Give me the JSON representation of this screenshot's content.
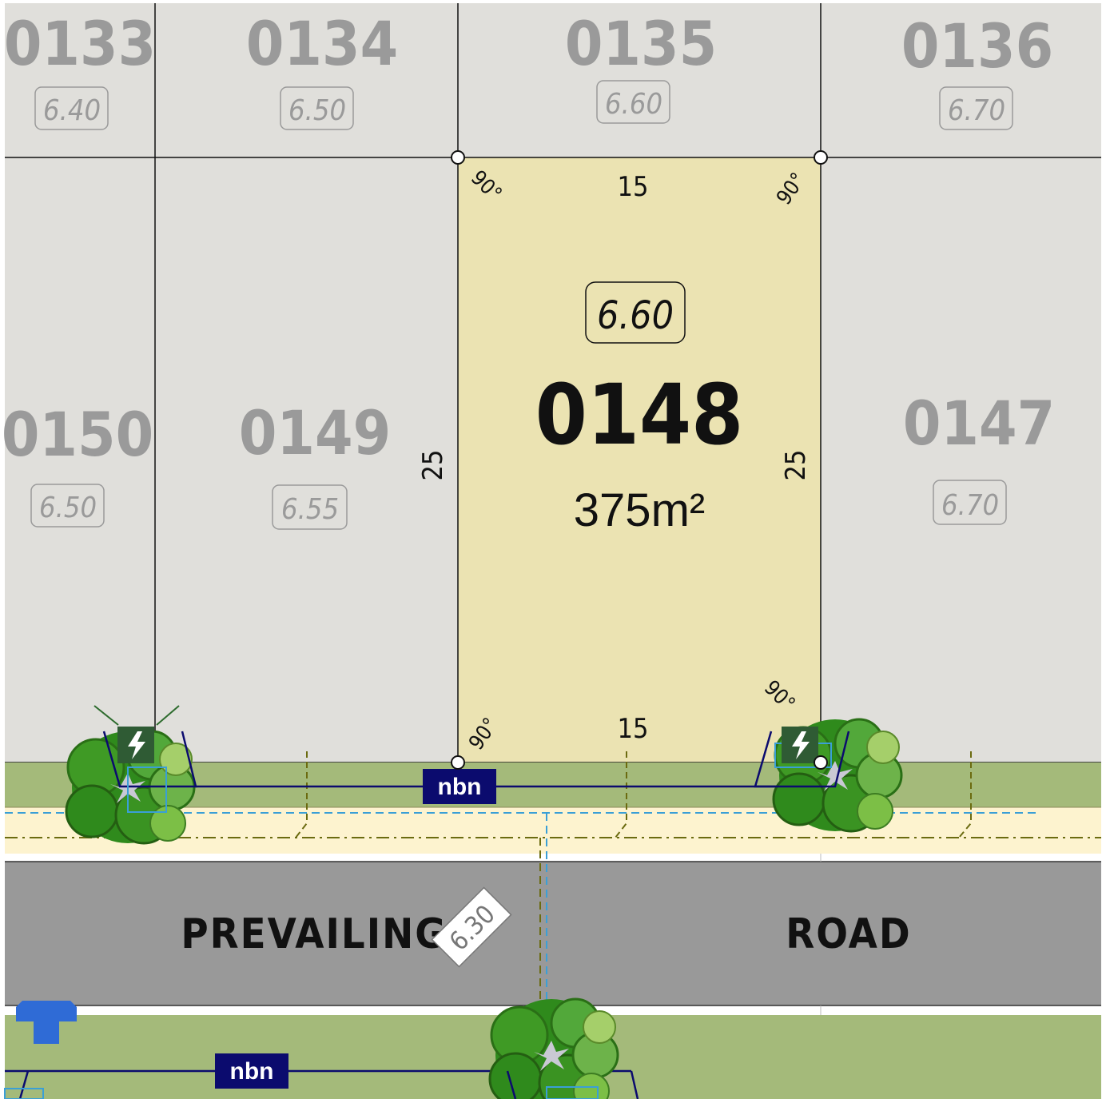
{
  "colors": {
    "lot_grey": "#e0dfdb",
    "lot_highlight": "#ebe3b2",
    "verge": "#a4ba7a",
    "footpath": "#fdf3cf",
    "road": "#999999",
    "nbn_bg": "#0b0b6e",
    "water_blue": "#3a9fd6",
    "boundary_line": "#111111",
    "hydrant_blue": "#2f6bd6"
  },
  "lots": [
    {
      "id": "0133",
      "level": "6.40"
    },
    {
      "id": "0134",
      "level": "6.50"
    },
    {
      "id": "0135",
      "level": "6.60"
    },
    {
      "id": "0136",
      "level": "6.70"
    },
    {
      "id": "0150",
      "level": "6.50"
    },
    {
      "id": "0149",
      "level": "6.55"
    },
    {
      "id": "0147",
      "level": "6.70"
    }
  ],
  "selected_lot": {
    "id": "0148",
    "level": "6.60",
    "area": "375m²",
    "frontage_top": "15",
    "frontage_bottom": "15",
    "depth_left": "25",
    "depth_right": "25",
    "angle": "90°"
  },
  "road": {
    "name_left": "PREVAILING",
    "name_right": "ROAD",
    "level": "6.30"
  },
  "utilities": {
    "nbn_label": "nbn",
    "power_icon": "lightning-icon",
    "hydrant_icon": "hydrant-icon"
  }
}
